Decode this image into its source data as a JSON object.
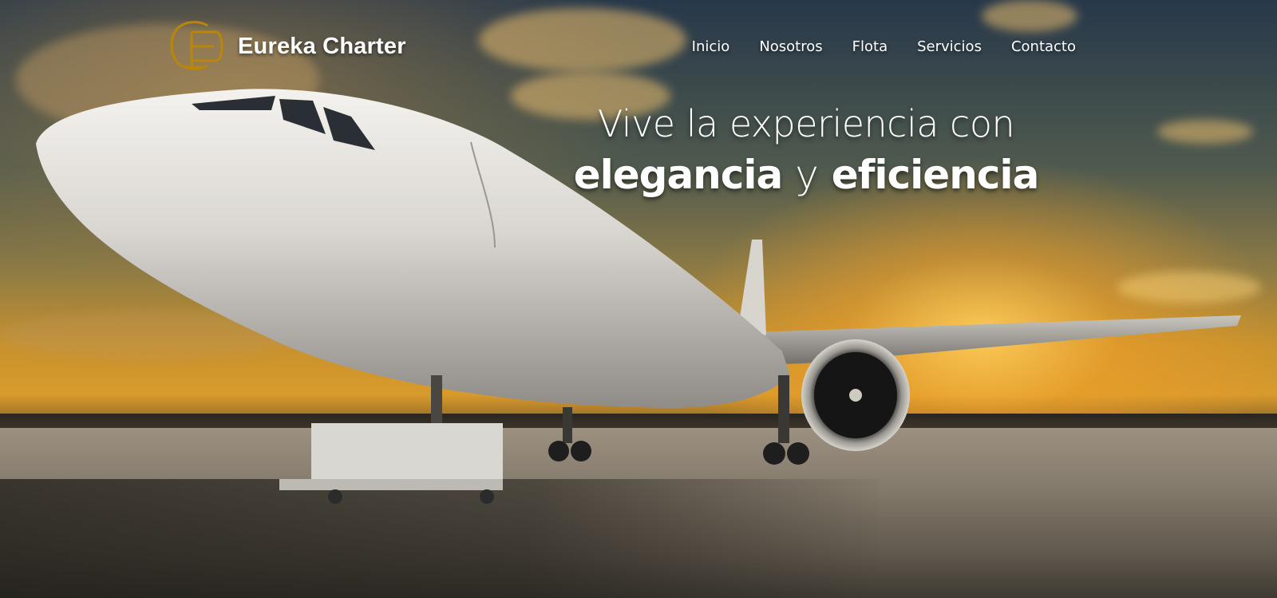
{
  "header": {
    "brand": "Eureka Charter",
    "nav": [
      {
        "label": "Inicio"
      },
      {
        "label": "Nosotros"
      },
      {
        "label": "Flota"
      },
      {
        "label": "Servicios"
      },
      {
        "label": "Contacto"
      }
    ]
  },
  "hero": {
    "line1": "Vive la experiencia con",
    "word1": "elegancia",
    "conjunction": "y",
    "word2": "eficiencia"
  },
  "colors": {
    "logo_gold": "#b8860b",
    "text": "#ffffff"
  },
  "icons": {
    "logo": "ec-monogram-logo"
  }
}
